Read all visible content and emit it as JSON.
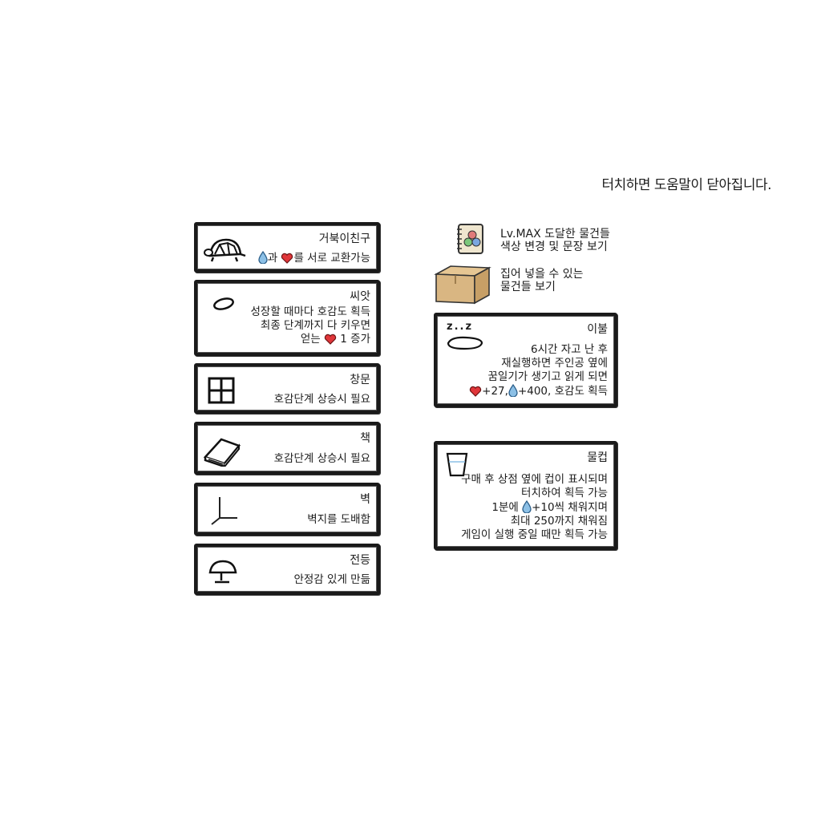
{
  "hint": "터치하면 도움말이 닫아집니다.",
  "left_items": [
    {
      "title": "거북이친구",
      "desc_a": "과 ",
      "desc_b": "를 서로 교환가능",
      "icon": "turtle-icon"
    },
    {
      "title": "씨앗",
      "line1": "성장할 때마다 호감도 획득",
      "line2": "최종 단계까지 다 키우면",
      "line3a": "얻는 ",
      "line3b": " 1 증가",
      "icon": "seed-icon"
    },
    {
      "title": "창문",
      "desc": "호감단계 상승시 필요",
      "icon": "window-icon"
    },
    {
      "title": "책",
      "desc": "호감단계 상승시 필요",
      "icon": "book-icon"
    },
    {
      "title": "벽",
      "desc": "벽지를 도배함",
      "icon": "wall-corner-icon"
    },
    {
      "title": "전등",
      "desc": "안정감 있게 만듦",
      "icon": "lamp-icon"
    }
  ],
  "palette": {
    "line1": "Lv.MAX 도달한 물건들",
    "line2": "색상 변경 및 문장 보기",
    "icon": "palette-notebook-icon"
  },
  "box": {
    "line1": "집어 넣을 수 있는",
    "line2": "물건들 보기",
    "icon": "cardboard-box-icon"
  },
  "blanket": {
    "title": "이불",
    "line1": "6시간 자고 난 후",
    "line2": "재실행하면 주인공 옆에",
    "line3": "꿈일기가 생기고 읽게 되면",
    "line4a": "+27,",
    "line4b": "+400, 호감도 획득",
    "sleep": "z..z",
    "icon": "blanket-icon"
  },
  "cup": {
    "title": "물컵",
    "line1": "구매 후 상점 옆에 컵이 표시되며",
    "line2": "터치하여 획득 가능",
    "line3a": "1분에 ",
    "line3b": "+10씩 채워지며",
    "line4": "최대 250까지 채워짐",
    "line5": "게임이 실행 중일 때만 획득 가능",
    "icon": "cup-icon"
  },
  "colors": {
    "heart": "#e0363a",
    "drop": "#6fa8d6",
    "border": "#1a1a1a",
    "box": "#d9b682"
  }
}
